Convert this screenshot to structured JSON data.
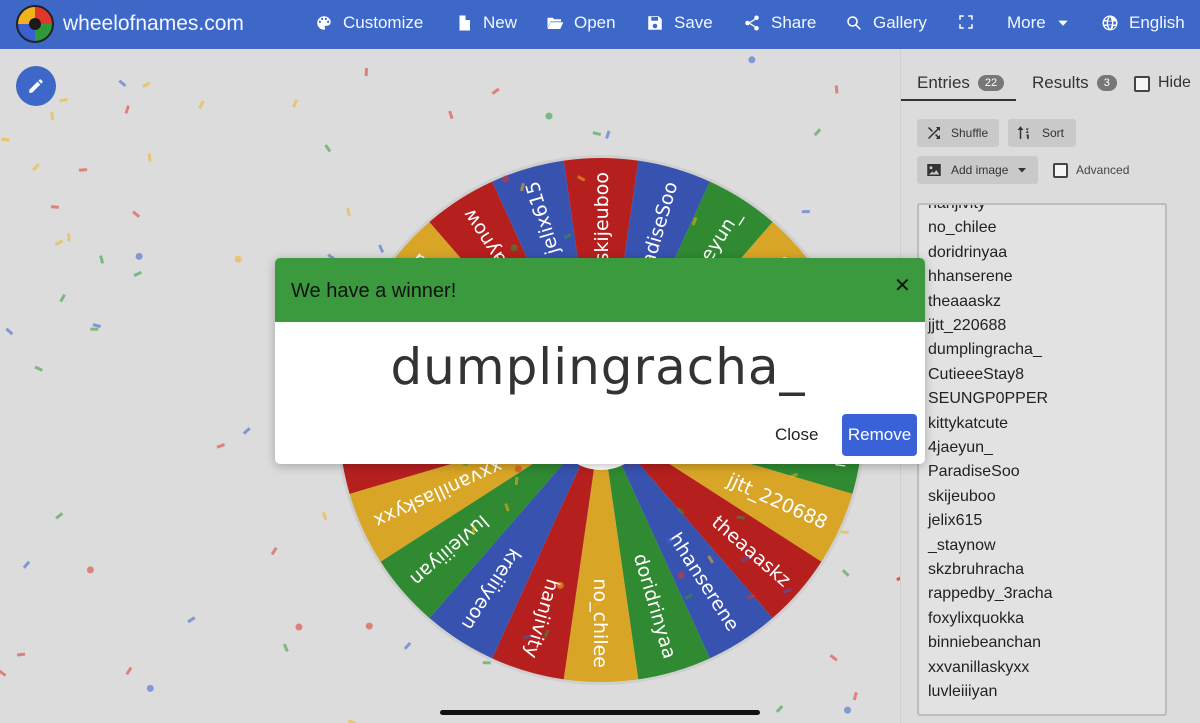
{
  "header": {
    "site_name": "wheelofnames.com",
    "nav": {
      "customize": "Customize",
      "new": "New",
      "open": "Open",
      "save": "Save",
      "share": "Share",
      "gallery": "Gallery",
      "more": "More",
      "language": "English"
    },
    "icons": [
      "palette-icon",
      "file-icon",
      "folder-open-icon",
      "save-icon",
      "share-icon",
      "search-icon",
      "fullscreen-icon",
      "chevron-down-icon",
      "globe-icon"
    ]
  },
  "sidebar": {
    "tabs": [
      {
        "label": "Entries",
        "count": "22"
      },
      {
        "label": "Results",
        "count": "3"
      }
    ],
    "hide_label": "Hide",
    "tools": {
      "shuffle": "Shuffle",
      "sort": "Sort",
      "add_image": "Add image",
      "advanced": "Advanced"
    },
    "entries": [
      "hanjivity",
      "no_chilee",
      "doridrinyaa",
      "hhanserene",
      "theaaaskz",
      "jjtt_220688",
      "dumplingracha_",
      "CutieeeStay8",
      "SEUNGP0PPER",
      "kittykatcute",
      "4jaeyun_",
      "ParadiseSoo",
      "skijeuboo",
      "jelix615",
      "_staynow",
      "skzbruhracha",
      "rappedby_3racha",
      "foxylixquokka",
      "binniebeanchan",
      "xxvanillaskyxx",
      "luvleiiiyan"
    ]
  },
  "wheel": {
    "segments": [
      "skijeuboo",
      "ParadiseSoo",
      "4jaeyun_",
      "kittykatcute",
      "SEUNGP0PPER",
      "CutieeeStay8",
      "dumplingracha_",
      "jjtt_220688",
      "theaaaskz",
      "hhanserene",
      "doridrinyaa",
      "no_chilee",
      "hanjivity",
      "kreiiiyeon",
      "luvleiiiyan",
      "xxvanillaskyxx",
      "binniebeanchan",
      "foxylixquokka",
      "rappedby_3racha",
      "skzbruhracha",
      "_staynow",
      "jelix615"
    ],
    "colors": [
      "#b5201e",
      "#3852b0",
      "#2f8a31",
      "#d9a526"
    ]
  },
  "dialog": {
    "title": "We have a winner!",
    "close_glyph": "✕",
    "winner": "dumplingracha_",
    "close_button": "Close",
    "remove_button": "Remove",
    "header_color": "#3b9a3e",
    "remove_color": "#3a62d8"
  }
}
